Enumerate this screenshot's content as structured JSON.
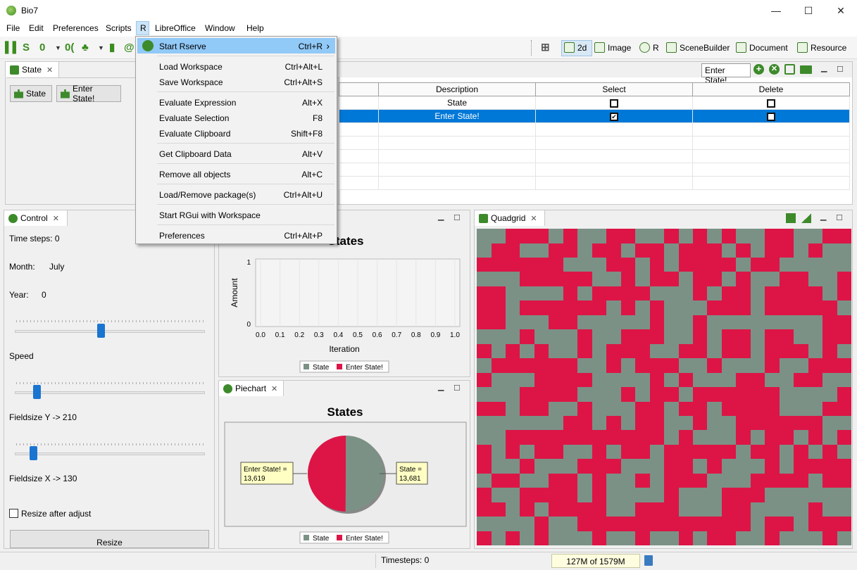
{
  "window": {
    "title": "Bio7",
    "min": "—",
    "max": "☐",
    "close": "✕"
  },
  "menubar": [
    "File",
    "Edit",
    "Preferences",
    "Scripts",
    "R",
    "LibreOffice",
    "Window",
    "Help"
  ],
  "perspectives": [
    "2d",
    "Image",
    "R",
    "SceneBuilder",
    "Document",
    "Resource"
  ],
  "state_panel": {
    "tab": "State",
    "btn_state": "State",
    "btn_enter": "Enter State!"
  },
  "table": {
    "headers": [
      "Description",
      "Select",
      "Delete"
    ],
    "rows": [
      {
        "description": "State",
        "select": false,
        "delete": false
      },
      {
        "description": "Enter State!",
        "select": true,
        "delete": false
      }
    ],
    "input_value": "Enter State!"
  },
  "r_menu": [
    {
      "label": "Start Rserve",
      "shortcut": "Ctrl+R",
      "submenu": true
    },
    {
      "label": "Load Workspace",
      "shortcut": "Ctrl+Alt+L"
    },
    {
      "label": "Save Workspace",
      "shortcut": "Ctrl+Alt+S"
    },
    {
      "label": "Evaluate Expression",
      "shortcut": "Alt+X"
    },
    {
      "label": "Evaluate Selection",
      "shortcut": "F8"
    },
    {
      "label": "Evaluate Clipboard",
      "shortcut": "Shift+F8"
    },
    {
      "label": "Get Clipboard Data",
      "shortcut": "Alt+V"
    },
    {
      "label": "Remove all objects",
      "shortcut": "Alt+C"
    },
    {
      "label": "Load/Remove package(s)",
      "shortcut": "Ctrl+Alt+U"
    },
    {
      "label": "Start RGui with Workspace",
      "shortcut": ""
    },
    {
      "label": "Preferences",
      "shortcut": "Ctrl+Alt+P"
    }
  ],
  "control": {
    "tab": "Control",
    "timesteps": "Time steps: 0",
    "month_label": "Month:",
    "month": "July",
    "year_label": "Year:",
    "year": "0",
    "speed": "Speed",
    "fieldsize_y": "Fieldsize Y -> 210",
    "fieldsize_x": "Fieldsize X -> 130",
    "resize_after": "Resize after adjust",
    "resize": "Resize",
    "speed_slider": 0.45,
    "speed_slider2": 0.1,
    "fy_slider": 0.08
  },
  "linechart": {
    "title": "States",
    "ylabel": "Amount",
    "xlabel": "Iteration",
    "legend": [
      "State",
      "Enter State!"
    ]
  },
  "piechart": {
    "tab": "Piechart",
    "title": "States",
    "legend": [
      "State",
      "Enter State!"
    ],
    "label_enter": "Enter State! =",
    "value_enter": "13,619",
    "label_state": "State =",
    "value_state": "13,681"
  },
  "quadgrid": {
    "tab": "Quadgrid"
  },
  "status": {
    "timesteps": "Timesteps: 0",
    "memory": "127M of 1579M"
  },
  "colors": {
    "state": "#7b9186",
    "enter": "#dc1546",
    "selection": "#0078d7"
  },
  "chart_data": [
    {
      "type": "line",
      "title": "States",
      "xlabel": "Iteration",
      "ylabel": "Amount",
      "xlim": [
        0,
        1
      ],
      "ylim": [
        0,
        1
      ],
      "x_ticks": [
        "0.0",
        "0.1",
        "0.2",
        "0.3",
        "0.4",
        "0.5",
        "0.6",
        "0.7",
        "0.8",
        "0.9",
        "1.0"
      ],
      "y_ticks": [
        "0",
        "1"
      ],
      "series": [
        {
          "name": "State",
          "values": []
        },
        {
          "name": "Enter State!",
          "values": []
        }
      ]
    },
    {
      "type": "pie",
      "title": "States",
      "categories": [
        "State",
        "Enter State!"
      ],
      "values": [
        13681,
        13619
      ]
    }
  ]
}
